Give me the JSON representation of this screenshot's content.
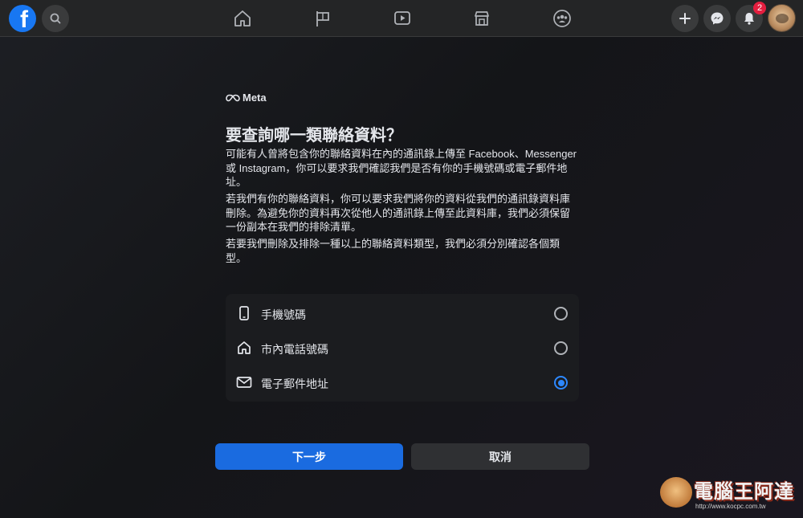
{
  "topbar": {
    "notification_count": "2",
    "icons": [
      "facebook-logo",
      "search-icon",
      "home-icon",
      "flag-icon",
      "video-icon",
      "marketplace-icon",
      "groups-icon",
      "plus-icon",
      "messenger-icon",
      "bell-icon",
      "avatar"
    ]
  },
  "dialog": {
    "brand": "Meta",
    "title": "要查詢哪一類聯絡資料？",
    "paragraphs": [
      "可能有人曾將包含你的聯絡資料在內的通訊錄上傳至 Facebook、Messenger 或 Instagram，你可以要求我們確認我們是否有你的手機號碼或電子郵件地址。",
      "若我們有你的聯絡資料，你可以要求我們將你的資料從我們的通訊錄資料庫刪除。為避免你的資料再次從他人的通訊錄上傳至此資料庫，我們必須保留一份副本在我們的排除清單。",
      "若要我們刪除及排除一種以上的聯絡資料類型，我們必須分別確認各個類型。"
    ],
    "options": [
      {
        "label": "手機號碼",
        "icon": "phone-icon",
        "selected": false
      },
      {
        "label": "市內電話號碼",
        "icon": "home-icon",
        "selected": false
      },
      {
        "label": "電子郵件地址",
        "icon": "mail-icon",
        "selected": true
      }
    ],
    "next_label": "下一步",
    "cancel_label": "取消"
  },
  "watermark": {
    "text": "電腦王阿達",
    "url": "http://www.kocpc.com.tw"
  },
  "colors": {
    "accent": "#1a6be0",
    "radio_selected": "#2d88ff",
    "badge": "#e41e3f",
    "facebook_blue": "#1877f2"
  }
}
